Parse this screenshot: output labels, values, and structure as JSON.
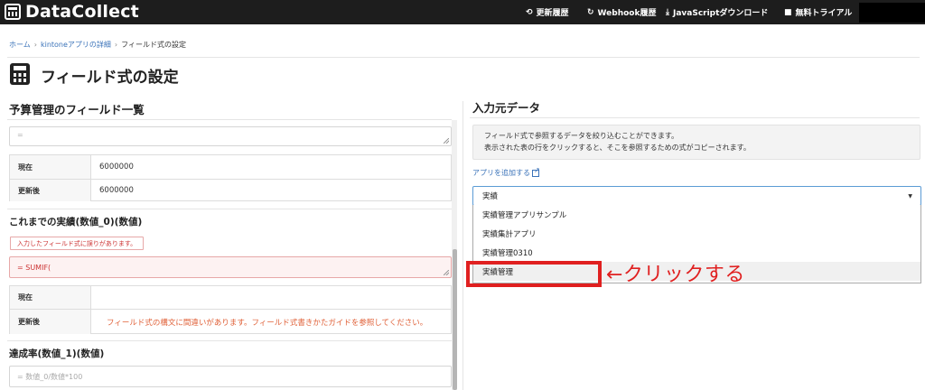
{
  "app": {
    "name": "DataCollect"
  },
  "nav": {
    "items": [
      {
        "label": "更新履歴",
        "icon": "history-icon"
      },
      {
        "label": "Webhook履歴",
        "icon": "refresh-icon"
      },
      {
        "label": "JavaScriptダウンロード",
        "icon": "download-icon"
      },
      {
        "label": "無料トライアル",
        "icon": "gift-icon"
      }
    ]
  },
  "breadcrumb": {
    "items": [
      "ホーム",
      "kintoneアプリの詳細",
      "フィールド式の設定"
    ],
    "separator": "›"
  },
  "page": {
    "title": "フィールド式の設定"
  },
  "left": {
    "heading": "予算管理のフィールド一覧",
    "top_field": {
      "value": "="
    },
    "table1": [
      {
        "key": "現在",
        "value": "6000000"
      },
      {
        "key": "更新後",
        "value": "6000000"
      }
    ],
    "field2": {
      "title": "これまでの実績(数値_0)(数値)",
      "error_badge": "入力したフィールド式に誤りがあります。",
      "formula": "= SUMIF(",
      "rows": [
        {
          "key": "現在",
          "value": ""
        },
        {
          "key": "更新後",
          "value": "フィールド式の構文に間違いがあります。フィールド式書きかたガイドを参照してください。"
        }
      ]
    },
    "field3": {
      "title": "達成率(数値_1)(数値)",
      "placeholder": "= 数値_0/数値*100"
    }
  },
  "right": {
    "heading": "入力元データ",
    "info_lines": [
      "フィールド式で参照するデータを絞り込むことができます。",
      "表示された表の行をクリックすると、そこを参照するための式がコピーされます。"
    ],
    "add_link": "アプリを追加する",
    "select_value": "実績",
    "options": [
      "実績管理アプリサンプル",
      "実績集計アプリ",
      "実績管理0310",
      "実績管理"
    ],
    "annotation": "←クリックする"
  },
  "colors": {
    "accent": "#3b73b9",
    "error": "#e0623a",
    "annotation": "#e02020",
    "topbar": "#1d1d1d"
  }
}
